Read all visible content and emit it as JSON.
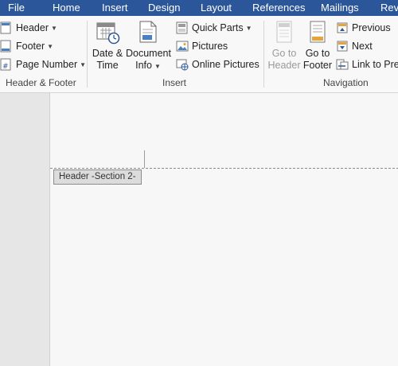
{
  "tabs": [
    "File",
    "Home",
    "Insert",
    "Design",
    "Layout",
    "References",
    "Mailings",
    "Revi"
  ],
  "ribbon": {
    "header_footer": {
      "header_label": "Header",
      "footer_label": "Footer",
      "page_number_label": "Page Number",
      "group_label": "Header & Footer"
    },
    "insert": {
      "date_time_line1": "Date &",
      "date_time_line2": "Time",
      "document_info_line1": "Document",
      "document_info_line2": "Info",
      "quick_parts_label": "Quick Parts",
      "pictures_label": "Pictures",
      "online_pictures_label": "Online Pictures",
      "group_label": "Insert"
    },
    "navigation": {
      "goto_header_line1": "Go to",
      "goto_header_line2": "Header",
      "goto_footer_line1": "Go to",
      "goto_footer_line2": "Footer",
      "previous_label": "Previous",
      "next_label": "Next",
      "link_previous_label": "Link to Prev",
      "group_label": "Navigation"
    }
  },
  "document": {
    "header_tag": "Header -Section 2-"
  },
  "colors": {
    "tab_bar": "#2b579a",
    "ribbon": "#f8f8f8",
    "page": "#f7f7f7"
  }
}
